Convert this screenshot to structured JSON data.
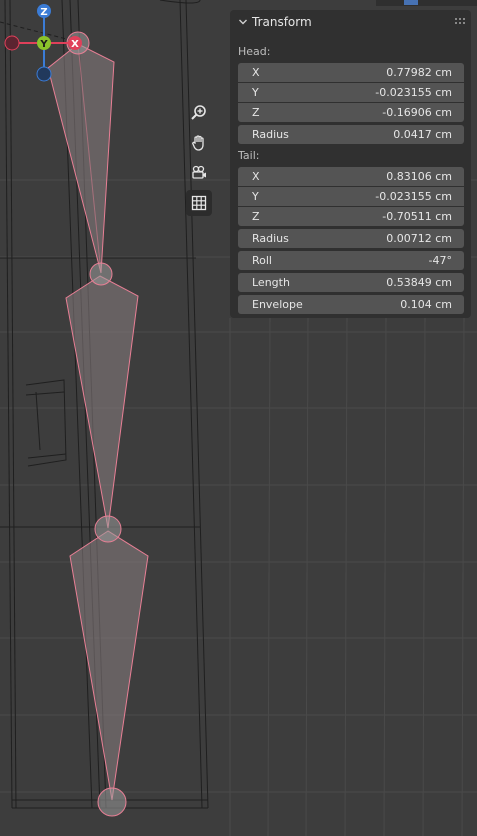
{
  "gizmo": {
    "z_label": "Z",
    "y_label": "Y",
    "x_label": "X"
  },
  "viewport_tools": [
    {
      "name": "zoom-icon"
    },
    {
      "name": "hand-pan-icon"
    },
    {
      "name": "camera-icon"
    },
    {
      "name": "grid-icon"
    }
  ],
  "panel": {
    "title": "Transform",
    "head": {
      "label": "Head:",
      "x": {
        "label": "X",
        "value": "0.77982 cm"
      },
      "y": {
        "label": "Y",
        "value": "-0.023155 cm"
      },
      "z": {
        "label": "Z",
        "value": "-0.16906 cm"
      },
      "radius": {
        "label": "Radius",
        "value": "0.0417 cm"
      }
    },
    "tail": {
      "label": "Tail:",
      "x": {
        "label": "X",
        "value": "0.83106 cm"
      },
      "y": {
        "label": "Y",
        "value": "-0.023155 cm"
      },
      "z": {
        "label": "Z",
        "value": "-0.70511 cm"
      },
      "radius": {
        "label": "Radius",
        "value": "0.00712 cm"
      }
    },
    "roll": {
      "label": "Roll",
      "value": "-47°"
    },
    "length": {
      "label": "Length",
      "value": "0.53849 cm"
    },
    "envelope": {
      "label": "Envelope",
      "value": "0.104 cm"
    }
  },
  "colors": {
    "bone_outline": "#e87f95",
    "axis_x": "#e0405a",
    "axis_y": "#8bc42b",
    "axis_z": "#3b7cd6",
    "panel_bg": "#303030",
    "field_bg": "#545454"
  }
}
